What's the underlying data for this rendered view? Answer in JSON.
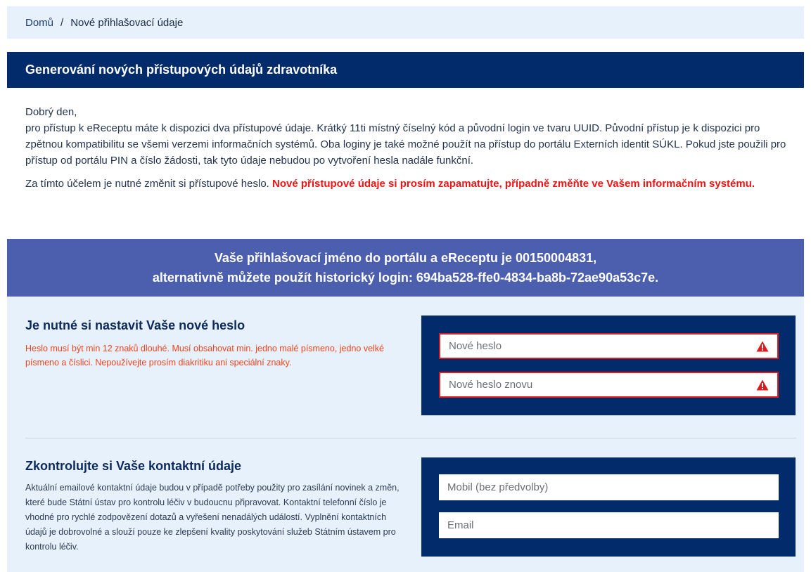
{
  "breadcrumb": {
    "home": "Domů",
    "separator": "/",
    "current": "Nové přihlašovací údaje"
  },
  "title": "Generování nových přístupových údajů zdravotníka",
  "intro": {
    "greeting": "Dobrý den,",
    "body": "pro přístup k eReceptu máte k dispozici dva přístupové údaje. Krátký 11ti místný číselný kód a původní login ve tvaru UUID. Původní přístup je k dispozici pro zpětnou kompatibilitu se všemi verzemi informačních systémů. Oba loginy je také možné použít na přístup do portálu Externích identit SÚKL. Pokud jste použili pro přístup od portálu PIN a číslo žádosti, tak tyto údaje nebudou po vytvoření hesla nadále funkční.",
    "note": "Za tímto účelem je nutné změnit si přístupové heslo. ",
    "warning": "Nové přístupové údaje si prosím zapamatujte, případně změňte ve Vašem informačním systému."
  },
  "login_banner": {
    "line1": "Vaše přihlašovací jméno do portálu a eReceptu je 00150004831,",
    "line2": "alternativně můžete použít historický login: 694ba528-ffe0-4834-ba8b-72ae90a53c7e."
  },
  "password_section": {
    "heading": "Je nutné si nastavit Vaše nové heslo",
    "rules": "Heslo musí být min 12 znaků dlouhé. Musí obsahovat min. jedno malé písmeno, jedno velké písmeno a číslici. Nepoužívejte prosím diakritiku ani speciální znaky.",
    "new_password_placeholder": "Nové heslo",
    "repeat_password_placeholder": "Nové heslo znovu",
    "warning_icon": "warning-triangle-icon",
    "error_color": "#e0191c"
  },
  "contact_section": {
    "heading": "Zkontrolujte si Vaše kontaktní údaje",
    "description": "Aktuální emailové kontaktní údaje budou v případě potřeby použity pro zasílání novinek a změn, které bude Státní ústav pro kontrolu léčiv v budoucnu připravovat. Kontaktní telefonní číslo je vhodné pro rychlé zodpovězení dotazů a vyřešení nenadálých událostí. Vyplnění kontaktních údajů je dobrovolné a slouží pouze ke zlepšení kvality poskytování služeb Státním ústavem pro kontrolu léčiv.",
    "mobile_placeholder": "Mobil (bez předvolby)",
    "email_placeholder": "Email"
  },
  "colors": {
    "navy": "#012b6b",
    "banner": "#4b5fae",
    "light_bg": "#e7f1fb",
    "alert_red": "#f01414"
  }
}
